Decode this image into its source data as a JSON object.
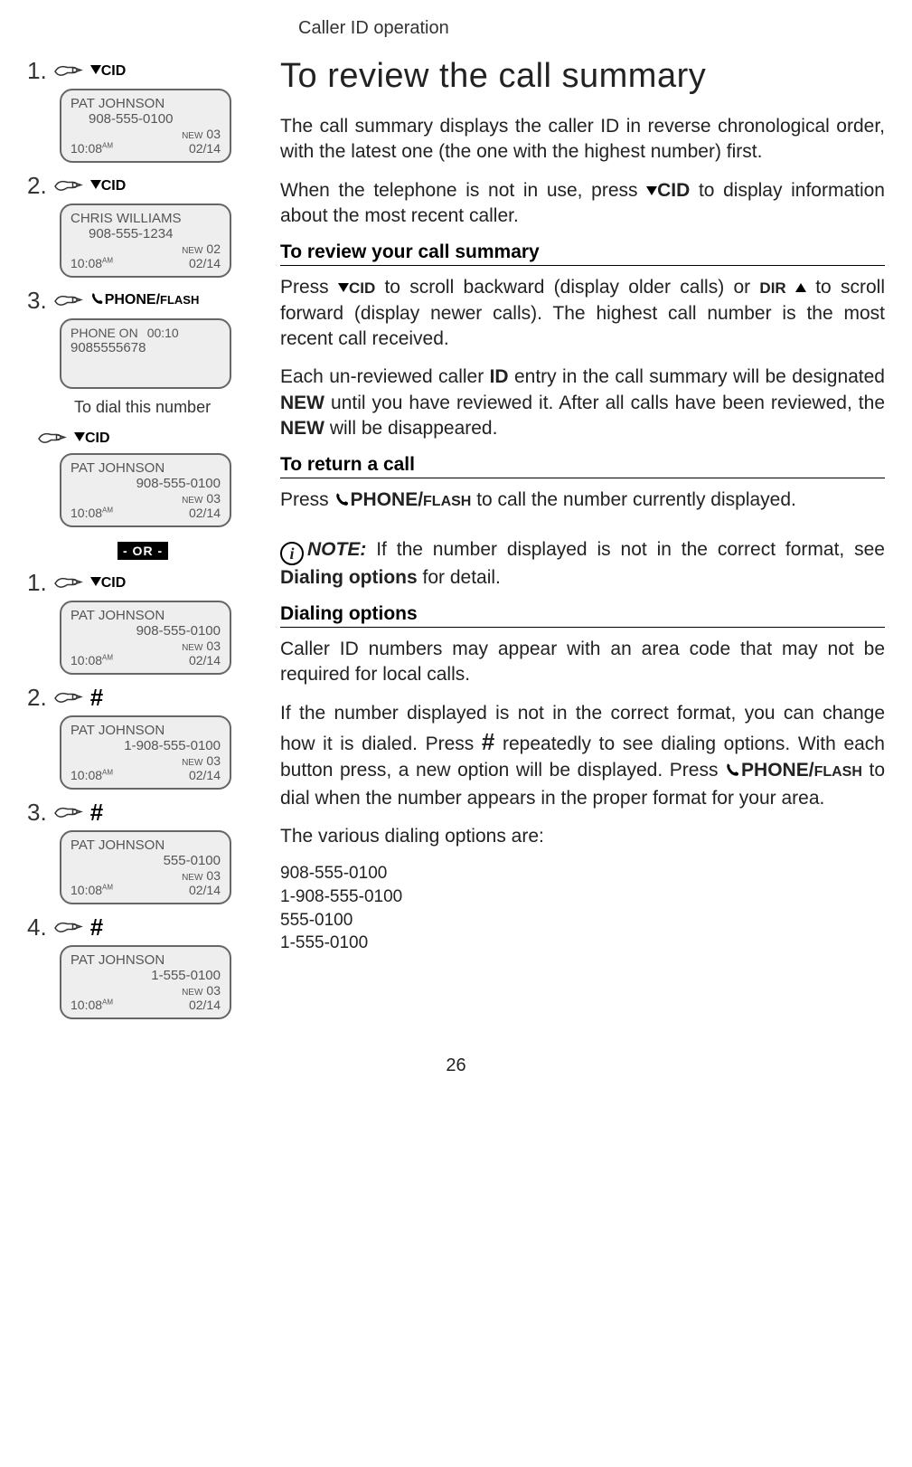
{
  "header": "Caller ID operation",
  "page_num": "26",
  "left": {
    "section_a": [
      {
        "num": "1.",
        "btn": "CID",
        "lcd": {
          "name": "PAT JOHNSON",
          "phone": "908-555-0100",
          "new": "NEW",
          "count": "03",
          "time": "10:08",
          "ampm": "AM",
          "date": "02/14",
          "phone_align": "left"
        }
      },
      {
        "num": "2.",
        "btn": "CID",
        "lcd": {
          "name": "CHRIS WILLIAMS",
          "phone": "908-555-1234",
          "new": "NEW",
          "count": "02",
          "time": "10:08",
          "ampm": "AM",
          "date": "02/14",
          "phone_align": "left"
        }
      }
    ],
    "section_a_dial": {
      "num": "3.",
      "btn_main": "PHONE/",
      "btn_sub": "FLASH",
      "lcd": {
        "line1a": "PHONE ON",
        "line1b": "00:10",
        "line2": "9085555678"
      },
      "caption": "To dial this number"
    },
    "section_a_tail": {
      "btn": "CID",
      "lcd": {
        "name": "PAT JOHNSON",
        "phone": "908-555-0100",
        "new": "NEW",
        "count": "03",
        "time": "10:08",
        "ampm": "AM",
        "date": "02/14",
        "phone_align": "right"
      }
    },
    "or_label": "- OR -",
    "section_b": [
      {
        "num": "1.",
        "btn": "CID",
        "btn_type": "cid",
        "lcd": {
          "name": "PAT JOHNSON",
          "phone": "908-555-0100",
          "new": "NEW",
          "count": "03",
          "time": "10:08",
          "ampm": "AM",
          "date": "02/14",
          "phone_align": "right"
        }
      },
      {
        "num": "2.",
        "btn": "#",
        "btn_type": "hash",
        "lcd": {
          "name": "PAT JOHNSON",
          "phone": "1-908-555-0100",
          "new": "NEW",
          "count": "03",
          "time": "10:08",
          "ampm": "AM",
          "date": "02/14",
          "phone_align": "right"
        }
      },
      {
        "num": "3.",
        "btn": "#",
        "btn_type": "hash",
        "lcd": {
          "name": "PAT JOHNSON",
          "phone": "555-0100",
          "new": "NEW",
          "count": "03",
          "time": "10:08",
          "ampm": "AM",
          "date": "02/14",
          "phone_align": "right"
        }
      },
      {
        "num": "4.",
        "btn": "#",
        "btn_type": "hash",
        "lcd": {
          "name": "PAT JOHNSON",
          "phone": "1-555-0100",
          "new": "NEW",
          "count": "03",
          "time": "10:08",
          "ampm": "AM",
          "date": "02/14",
          "phone_align": "right"
        }
      }
    ]
  },
  "right": {
    "title": "To review the call summary",
    "p1": "The call summary displays the caller ID in reverse chronological order, with the latest one (the one with the highest number) first.",
    "p2_a": "When the telephone is not in use, press ",
    "p2_b": "CID",
    "p2_c": " to display information about the most recent caller.",
    "h_review": "To review your call summary",
    "p3_a": "Press ",
    "p3_b": "CID",
    "p3_c": " to scroll backward (display older calls) or ",
    "p3_d": "DIR",
    "p3_e": " to scroll forward (display newer calls). The highest call number is the most recent call received.",
    "p4_a": "Each un-reviewed caller ",
    "p4_b": "ID",
    "p4_c": " entry in the call summary will be designated ",
    "p4_d": "NEW",
    "p4_e": " until you have reviewed it. After all calls have been reviewed, the ",
    "p4_f": "NEW",
    "p4_g": " will be disappeared.",
    "h_return": "To return a call",
    "p5_a": "Press ",
    "p5_b": "PHONE/",
    "p5_c": "FLASH",
    "p5_d": " to call the number currently displayed.",
    "note_label": "NOTE:",
    "p6_a": " If the number displayed is not in the correct format, see ",
    "p6_b": "Dialing options",
    "p6_c": " for detail.",
    "h_dial": "Dialing options",
    "p7": "Caller ID numbers may appear with an area code that may not be required for local calls.",
    "p8_a": "If the number displayed is not in the correct format, you can change how it is dialed. Press ",
    "p8_hash": "#",
    "p8_b": " repeatedly to see dialing options. With each button press, a new option will be displayed. Press ",
    "p8_c": "PHONE/",
    "p8_d": "FLASH",
    "p8_e": " to dial when the number appears in the proper format for your area.",
    "p9": "The various dialing options are:",
    "dial_options": [
      "908-555-0100",
      "1-908-555-0100",
      "555-0100",
      "1-555-0100"
    ]
  }
}
